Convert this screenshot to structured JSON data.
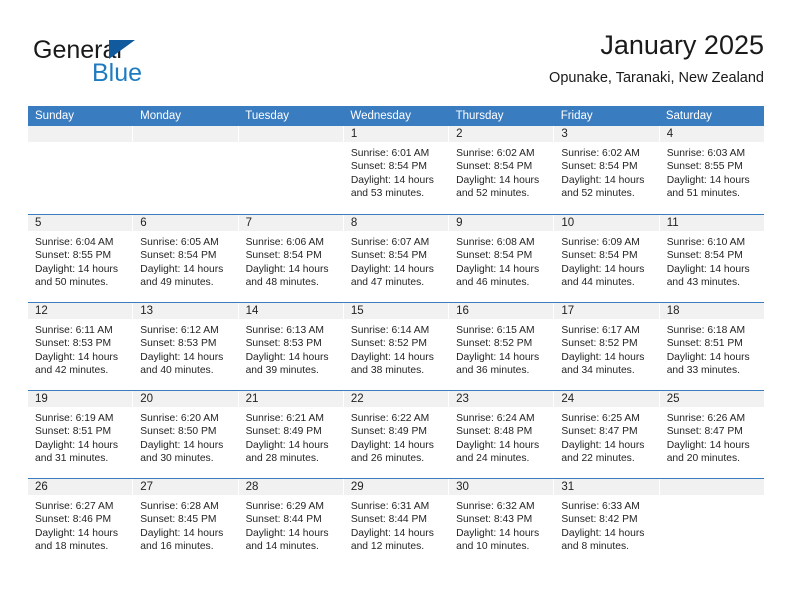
{
  "brand": {
    "name_part1": "General",
    "name_part2": "Blue",
    "logo_icon": "triangle-flag-icon",
    "accent_color": "#1f7bc1",
    "header_color": "#3a7cc0"
  },
  "header": {
    "title": "January 2025",
    "subtitle": "Opunake, Taranaki, New Zealand"
  },
  "calendar": {
    "weekday_headers": [
      "Sunday",
      "Monday",
      "Tuesday",
      "Wednesday",
      "Thursday",
      "Friday",
      "Saturday"
    ],
    "weeks": [
      [
        {
          "day": "",
          "empty": true,
          "sunrise": "",
          "sunset": "",
          "daylight1": "",
          "daylight2": ""
        },
        {
          "day": "",
          "empty": true,
          "sunrise": "",
          "sunset": "",
          "daylight1": "",
          "daylight2": ""
        },
        {
          "day": "",
          "empty": true,
          "sunrise": "",
          "sunset": "",
          "daylight1": "",
          "daylight2": ""
        },
        {
          "day": "1",
          "empty": false,
          "sunrise": "Sunrise: 6:01 AM",
          "sunset": "Sunset: 8:54 PM",
          "daylight1": "Daylight: 14 hours",
          "daylight2": "and 53 minutes."
        },
        {
          "day": "2",
          "empty": false,
          "sunrise": "Sunrise: 6:02 AM",
          "sunset": "Sunset: 8:54 PM",
          "daylight1": "Daylight: 14 hours",
          "daylight2": "and 52 minutes."
        },
        {
          "day": "3",
          "empty": false,
          "sunrise": "Sunrise: 6:02 AM",
          "sunset": "Sunset: 8:54 PM",
          "daylight1": "Daylight: 14 hours",
          "daylight2": "and 52 minutes."
        },
        {
          "day": "4",
          "empty": false,
          "sunrise": "Sunrise: 6:03 AM",
          "sunset": "Sunset: 8:55 PM",
          "daylight1": "Daylight: 14 hours",
          "daylight2": "and 51 minutes."
        }
      ],
      [
        {
          "day": "5",
          "empty": false,
          "sunrise": "Sunrise: 6:04 AM",
          "sunset": "Sunset: 8:55 PM",
          "daylight1": "Daylight: 14 hours",
          "daylight2": "and 50 minutes."
        },
        {
          "day": "6",
          "empty": false,
          "sunrise": "Sunrise: 6:05 AM",
          "sunset": "Sunset: 8:54 PM",
          "daylight1": "Daylight: 14 hours",
          "daylight2": "and 49 minutes."
        },
        {
          "day": "7",
          "empty": false,
          "sunrise": "Sunrise: 6:06 AM",
          "sunset": "Sunset: 8:54 PM",
          "daylight1": "Daylight: 14 hours",
          "daylight2": "and 48 minutes."
        },
        {
          "day": "8",
          "empty": false,
          "sunrise": "Sunrise: 6:07 AM",
          "sunset": "Sunset: 8:54 PM",
          "daylight1": "Daylight: 14 hours",
          "daylight2": "and 47 minutes."
        },
        {
          "day": "9",
          "empty": false,
          "sunrise": "Sunrise: 6:08 AM",
          "sunset": "Sunset: 8:54 PM",
          "daylight1": "Daylight: 14 hours",
          "daylight2": "and 46 minutes."
        },
        {
          "day": "10",
          "empty": false,
          "sunrise": "Sunrise: 6:09 AM",
          "sunset": "Sunset: 8:54 PM",
          "daylight1": "Daylight: 14 hours",
          "daylight2": "and 44 minutes."
        },
        {
          "day": "11",
          "empty": false,
          "sunrise": "Sunrise: 6:10 AM",
          "sunset": "Sunset: 8:54 PM",
          "daylight1": "Daylight: 14 hours",
          "daylight2": "and 43 minutes."
        }
      ],
      [
        {
          "day": "12",
          "empty": false,
          "sunrise": "Sunrise: 6:11 AM",
          "sunset": "Sunset: 8:53 PM",
          "daylight1": "Daylight: 14 hours",
          "daylight2": "and 42 minutes."
        },
        {
          "day": "13",
          "empty": false,
          "sunrise": "Sunrise: 6:12 AM",
          "sunset": "Sunset: 8:53 PM",
          "daylight1": "Daylight: 14 hours",
          "daylight2": "and 40 minutes."
        },
        {
          "day": "14",
          "empty": false,
          "sunrise": "Sunrise: 6:13 AM",
          "sunset": "Sunset: 8:53 PM",
          "daylight1": "Daylight: 14 hours",
          "daylight2": "and 39 minutes."
        },
        {
          "day": "15",
          "empty": false,
          "sunrise": "Sunrise: 6:14 AM",
          "sunset": "Sunset: 8:52 PM",
          "daylight1": "Daylight: 14 hours",
          "daylight2": "and 38 minutes."
        },
        {
          "day": "16",
          "empty": false,
          "sunrise": "Sunrise: 6:15 AM",
          "sunset": "Sunset: 8:52 PM",
          "daylight1": "Daylight: 14 hours",
          "daylight2": "and 36 minutes."
        },
        {
          "day": "17",
          "empty": false,
          "sunrise": "Sunrise: 6:17 AM",
          "sunset": "Sunset: 8:52 PM",
          "daylight1": "Daylight: 14 hours",
          "daylight2": "and 34 minutes."
        },
        {
          "day": "18",
          "empty": false,
          "sunrise": "Sunrise: 6:18 AM",
          "sunset": "Sunset: 8:51 PM",
          "daylight1": "Daylight: 14 hours",
          "daylight2": "and 33 minutes."
        }
      ],
      [
        {
          "day": "19",
          "empty": false,
          "sunrise": "Sunrise: 6:19 AM",
          "sunset": "Sunset: 8:51 PM",
          "daylight1": "Daylight: 14 hours",
          "daylight2": "and 31 minutes."
        },
        {
          "day": "20",
          "empty": false,
          "sunrise": "Sunrise: 6:20 AM",
          "sunset": "Sunset: 8:50 PM",
          "daylight1": "Daylight: 14 hours",
          "daylight2": "and 30 minutes."
        },
        {
          "day": "21",
          "empty": false,
          "sunrise": "Sunrise: 6:21 AM",
          "sunset": "Sunset: 8:49 PM",
          "daylight1": "Daylight: 14 hours",
          "daylight2": "and 28 minutes."
        },
        {
          "day": "22",
          "empty": false,
          "sunrise": "Sunrise: 6:22 AM",
          "sunset": "Sunset: 8:49 PM",
          "daylight1": "Daylight: 14 hours",
          "daylight2": "and 26 minutes."
        },
        {
          "day": "23",
          "empty": false,
          "sunrise": "Sunrise: 6:24 AM",
          "sunset": "Sunset: 8:48 PM",
          "daylight1": "Daylight: 14 hours",
          "daylight2": "and 24 minutes."
        },
        {
          "day": "24",
          "empty": false,
          "sunrise": "Sunrise: 6:25 AM",
          "sunset": "Sunset: 8:47 PM",
          "daylight1": "Daylight: 14 hours",
          "daylight2": "and 22 minutes."
        },
        {
          "day": "25",
          "empty": false,
          "sunrise": "Sunrise: 6:26 AM",
          "sunset": "Sunset: 8:47 PM",
          "daylight1": "Daylight: 14 hours",
          "daylight2": "and 20 minutes."
        }
      ],
      [
        {
          "day": "26",
          "empty": false,
          "sunrise": "Sunrise: 6:27 AM",
          "sunset": "Sunset: 8:46 PM",
          "daylight1": "Daylight: 14 hours",
          "daylight2": "and 18 minutes."
        },
        {
          "day": "27",
          "empty": false,
          "sunrise": "Sunrise: 6:28 AM",
          "sunset": "Sunset: 8:45 PM",
          "daylight1": "Daylight: 14 hours",
          "daylight2": "and 16 minutes."
        },
        {
          "day": "28",
          "empty": false,
          "sunrise": "Sunrise: 6:29 AM",
          "sunset": "Sunset: 8:44 PM",
          "daylight1": "Daylight: 14 hours",
          "daylight2": "and 14 minutes."
        },
        {
          "day": "29",
          "empty": false,
          "sunrise": "Sunrise: 6:31 AM",
          "sunset": "Sunset: 8:44 PM",
          "daylight1": "Daylight: 14 hours",
          "daylight2": "and 12 minutes."
        },
        {
          "day": "30",
          "empty": false,
          "sunrise": "Sunrise: 6:32 AM",
          "sunset": "Sunset: 8:43 PM",
          "daylight1": "Daylight: 14 hours",
          "daylight2": "and 10 minutes."
        },
        {
          "day": "31",
          "empty": false,
          "sunrise": "Sunrise: 6:33 AM",
          "sunset": "Sunset: 8:42 PM",
          "daylight1": "Daylight: 14 hours",
          "daylight2": "and 8 minutes."
        },
        {
          "day": "",
          "empty": true,
          "sunrise": "",
          "sunset": "",
          "daylight1": "",
          "daylight2": ""
        }
      ]
    ]
  }
}
